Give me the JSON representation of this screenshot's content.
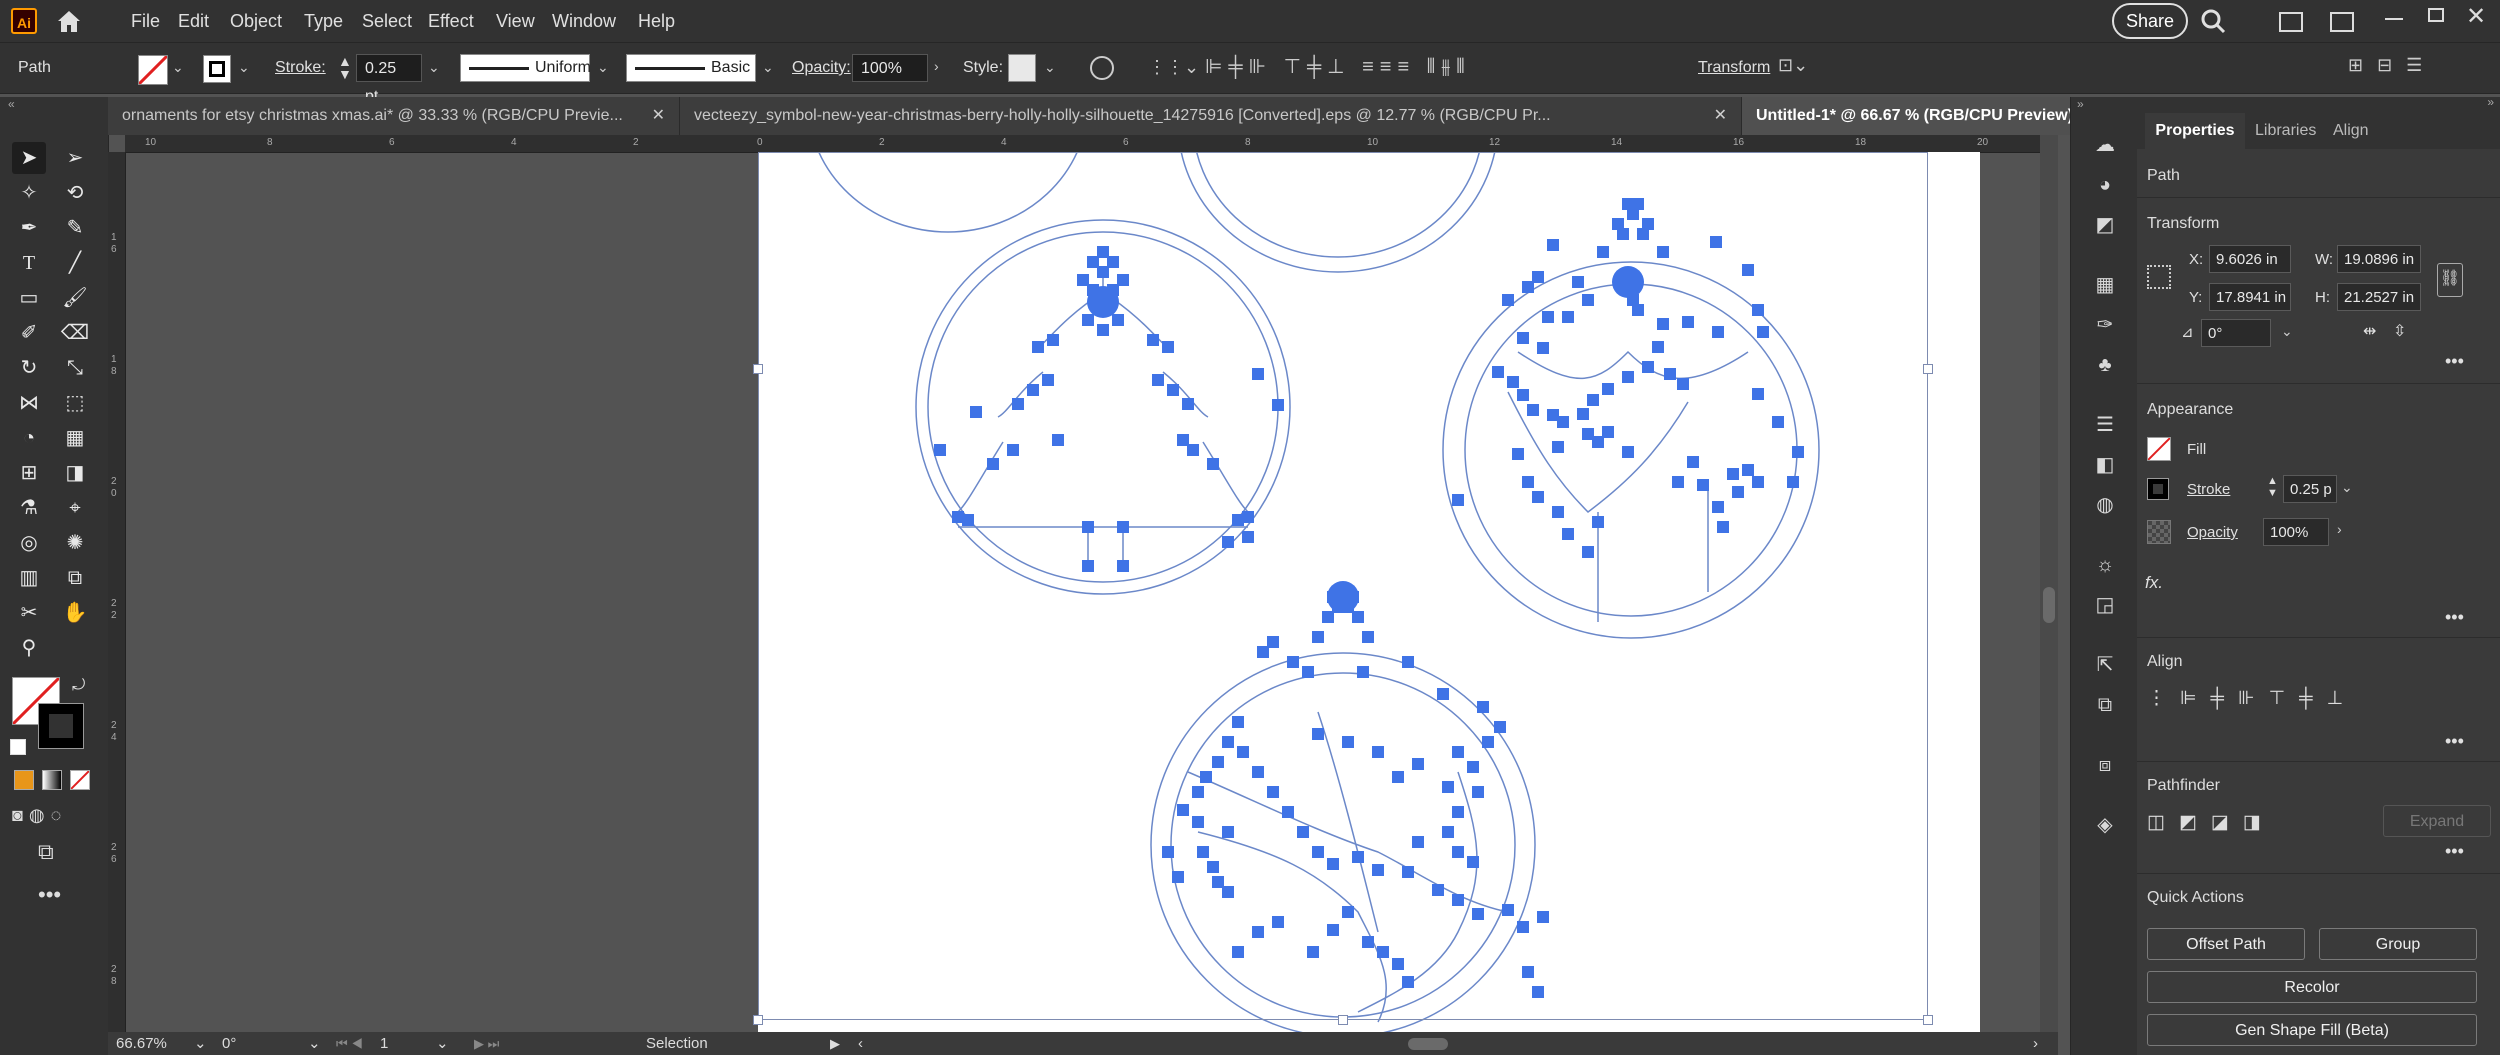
{
  "app": {
    "logo_text": "Ai",
    "menus": [
      "File",
      "Edit",
      "Object",
      "Type",
      "Select",
      "Effect",
      "View",
      "Window",
      "Help"
    ],
    "share_label": "Share"
  },
  "control": {
    "selection_type": "Path",
    "stroke_label": "Stroke:",
    "stroke_weight": "0.25 pt",
    "profile": "Uniform",
    "brush": "Basic",
    "opacity_label": "Opacity:",
    "opacity": "100%",
    "style_label": "Style:",
    "transform_label": "Transform"
  },
  "tabs": [
    {
      "label": "ornaments for etsy christmas xmas.ai* @ 33.33 % (RGB/CPU Previe..."
    },
    {
      "label": "vecteezy_symbol-new-year-christmas-berry-holly-holly-silhouette_14275916 [Converted].eps @ 12.77 % (RGB/CPU Pr..."
    },
    {
      "label": "Untitled-1* @ 66.67 % (RGB/CPU Preview)"
    }
  ],
  "ruler": {
    "h_labels": [
      "10",
      "8",
      "6",
      "4",
      "2",
      "0",
      "2",
      "4",
      "6",
      "8",
      "10",
      "12",
      "14",
      "16",
      "18",
      "20"
    ],
    "v_labels": [
      "1",
      "6",
      "1",
      "8",
      "2",
      "0",
      "2",
      "2",
      "2",
      "4",
      "2",
      "6",
      "2",
      "8"
    ]
  },
  "status": {
    "zoom": "66.67%",
    "rotation": "0°",
    "artboard": "1",
    "tool": "Selection"
  },
  "panel": {
    "tabs": [
      "Properties",
      "Libraries",
      "Align"
    ],
    "object_type": "Path",
    "transform": {
      "title": "Transform",
      "x_label": "X:",
      "x": "9.6026 in",
      "y_label": "Y:",
      "y": "17.8941 in",
      "w_label": "W:",
      "w": "19.0896 in",
      "h_label": "H:",
      "h": "21.2527 in",
      "angle": "0°"
    },
    "appearance": {
      "title": "Appearance",
      "fill_label": "Fill",
      "stroke_label": "Stroke",
      "stroke_value": "0.25 p",
      "opacity_label": "Opacity",
      "opacity_value": "100%",
      "fx_label": "fx."
    },
    "align_title": "Align",
    "pathfinder": {
      "title": "Pathfinder",
      "expand": "Expand"
    },
    "quick_actions": {
      "title": "Quick Actions",
      "offset_path": "Offset Path",
      "group": "Group",
      "recolor": "Recolor",
      "gen_shape_fill": "Gen Shape Fill (Beta)"
    }
  },
  "colors": {
    "path_blue": "#4a7ee8",
    "anchor_blue": "#3f73e6",
    "panel_bg": "#3a3a3a",
    "bar_bg": "#323232"
  }
}
